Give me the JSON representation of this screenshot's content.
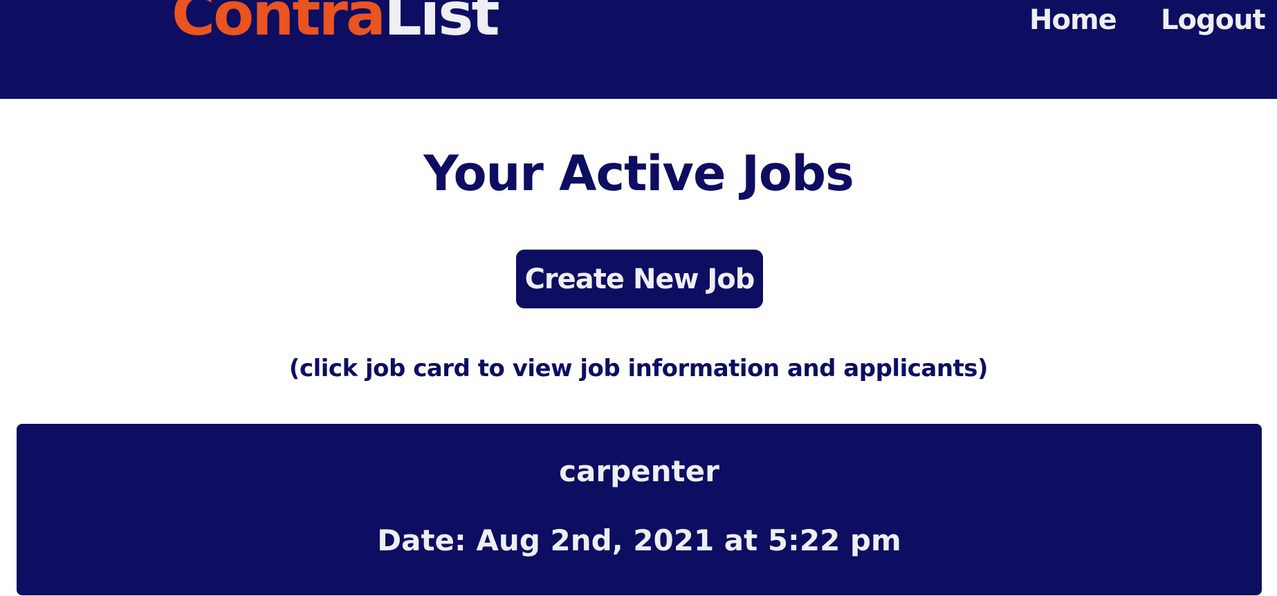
{
  "header": {
    "logo_part_a": "Contra",
    "logo_part_b": "List",
    "nav": {
      "home": "Home",
      "logout": "Logout"
    }
  },
  "main": {
    "title": "Your Active Jobs",
    "create_button": "Create New Job",
    "hint": "(click job card to view job information and applicants)",
    "jobs": [
      {
        "title": "carpenter",
        "date": "Date: Aug 2nd, 2021 at 5:22 pm"
      }
    ]
  },
  "colors": {
    "primary": "#0d0d62",
    "accent": "#e95420",
    "light_text": "#eeeef4",
    "background": "#ffffff"
  }
}
